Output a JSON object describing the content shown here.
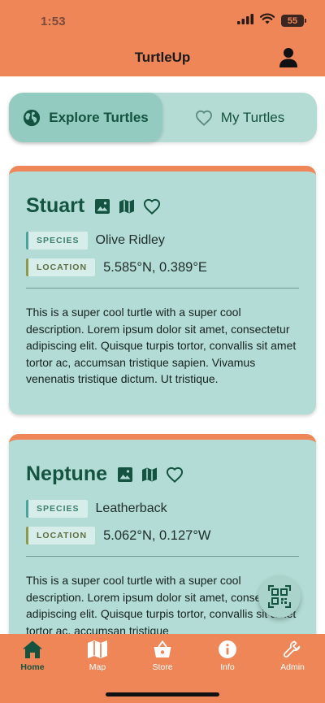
{
  "status_bar": {
    "time": "1:53",
    "battery": "55"
  },
  "header": {
    "title": "TurtleUp"
  },
  "segmented_control": {
    "options": [
      {
        "label": "Explore Turtles",
        "icon": "globe-icon",
        "selected": true
      },
      {
        "label": "My Turtles",
        "icon": "heart-outline-icon",
        "selected": false
      }
    ]
  },
  "turtles": [
    {
      "name": "Stuart",
      "species_tag": "SPECIES",
      "species": "Olive Ridley",
      "location_tag": "LOCATION",
      "location": "5.585°N, 0.389°E",
      "description": "This is a super cool turtle with a super cool description. Lorem ipsum dolor sit amet, consectetur adipiscing elit. Quisque turpis tortor, convallis sit amet tortor ac, accumsan tristique sapien. Vivamus venenatis tristique dictum. Ut tristique."
    },
    {
      "name": "Neptune",
      "species_tag": "SPECIES",
      "species": "Leatherback",
      "location_tag": "LOCATION",
      "location": "5.062°N, 0.127°W",
      "description": "This is a super cool turtle with a super cool description. Lorem ipsum dolor sit amet, consectetur adipiscing elit. Quisque turpis tortor, convallis sit amet tortor ac, accumsan tristique"
    }
  ],
  "tabbar": {
    "items": [
      {
        "label": "Home",
        "icon": "home-icon",
        "active": true
      },
      {
        "label": "Map",
        "icon": "map-icon",
        "active": false
      },
      {
        "label": "Store",
        "icon": "basket-icon",
        "active": false
      },
      {
        "label": "Info",
        "icon": "info-icon",
        "active": false
      },
      {
        "label": "Admin",
        "icon": "wrench-icon",
        "active": false
      }
    ]
  },
  "colors": {
    "brand_orange": "#ee8657",
    "card_teal": "#b2dcd5",
    "dark_green": "#14533f"
  }
}
